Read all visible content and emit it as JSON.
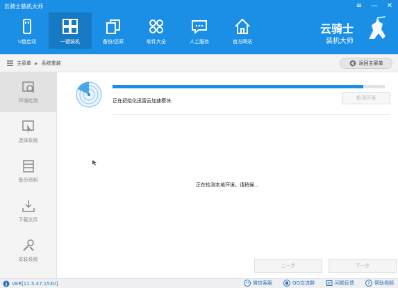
{
  "window": {
    "title": "云骑士装机大师",
    "buttons": {
      "menu": "≡",
      "minimize": "—",
      "close": "✕"
    }
  },
  "nav": [
    {
      "label": "U盘启动",
      "icon": "usb-icon"
    },
    {
      "label": "一键装机",
      "icon": "windows-icon",
      "active": true
    },
    {
      "label": "备份/还原",
      "icon": "backup-icon"
    },
    {
      "label": "软件大全",
      "icon": "apps-grid-icon"
    },
    {
      "label": "人工服务",
      "icon": "chat-icon"
    },
    {
      "label": "官方网站",
      "icon": "home-icon"
    }
  ],
  "brand": {
    "top": "云骑士",
    "bottom": "装机大师"
  },
  "breadcrumb": {
    "home": "主菜单",
    "separator": "▶",
    "current": "系统重装"
  },
  "back_button": {
    "label": "返回主菜单"
  },
  "sidebar": [
    {
      "label": "环境检测",
      "icon": "env-check-icon",
      "active": true
    },
    {
      "label": "选择系统",
      "icon": "select-system-icon"
    },
    {
      "label": "备份资料",
      "icon": "backup-data-icon"
    },
    {
      "label": "下载文件",
      "icon": "download-icon"
    },
    {
      "label": "安装系统",
      "icon": "install-tools-icon"
    }
  ],
  "main": {
    "progress_fraction": 0.92,
    "status_text": "正在初始化迅雷云加速模块.",
    "env_button": "检测环境",
    "checking_text": "正在检测本地环境，请稍候...",
    "prev_button": "上一步",
    "next_button": "下一步"
  },
  "footer": {
    "version": "VER[11.5.47.1530]",
    "links": [
      {
        "label": "微信客服",
        "icon": "wechat-icon"
      },
      {
        "label": "QQ交流群",
        "icon": "qq-icon"
      },
      {
        "label": "问题反馈",
        "icon": "feedback-icon"
      },
      {
        "label": "帮助视频",
        "icon": "help-video-icon"
      }
    ]
  },
  "colors": {
    "accent": "#1b8fe6",
    "sidebar_bg": "#f4f4f4",
    "link": "#2a6fb8"
  }
}
